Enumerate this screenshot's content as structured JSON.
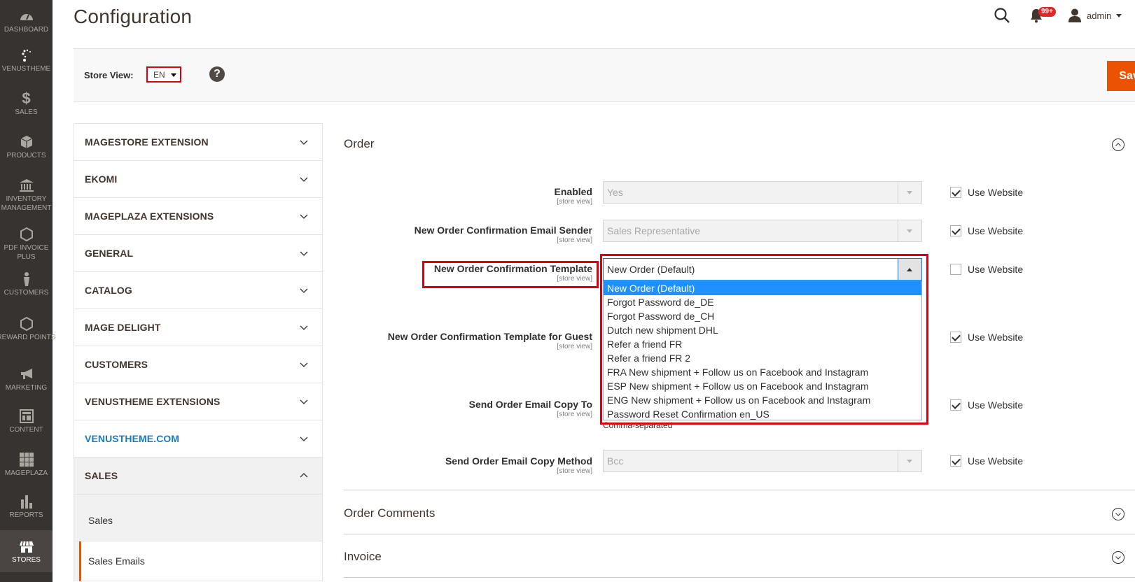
{
  "nav": {
    "items": [
      {
        "label": "DASHBOARD",
        "icon": "dashboard-icon"
      },
      {
        "label": "VENUSTHEME",
        "icon": "venustheme-icon"
      },
      {
        "label": "SALES",
        "icon": "dollar-icon"
      },
      {
        "label": "PRODUCTS",
        "icon": "box-icon"
      },
      {
        "label": "INVENTORY MANAGEMENT",
        "icon": "bank-icon"
      },
      {
        "label": "PDF INVOICE PLUS",
        "icon": "hexagon-icon"
      },
      {
        "label": "CUSTOMERS",
        "icon": "person-icon"
      },
      {
        "label": "REWARD POINTS",
        "icon": "hexagon-icon"
      },
      {
        "label": "MARKETING",
        "icon": "megaphone-icon"
      },
      {
        "label": "CONTENT",
        "icon": "layout-icon"
      },
      {
        "label": "MAGEPLAZA",
        "icon": "grid-icon"
      },
      {
        "label": "REPORTS",
        "icon": "bar-chart-icon"
      },
      {
        "label": "STORES",
        "icon": "storefront-icon",
        "active": true
      }
    ]
  },
  "header": {
    "title": "Configuration",
    "notifications_count": "99+",
    "user": "admin"
  },
  "store_bar": {
    "label": "Store View:",
    "selected": "EN",
    "help": "?",
    "save_label": "Save Config"
  },
  "tabs": [
    {
      "label": "MAGESTORE EXTENSION"
    },
    {
      "label": "EKOMI"
    },
    {
      "label": "MAGEPLAZA EXTENSIONS"
    },
    {
      "label": "GENERAL"
    },
    {
      "label": "CATALOG"
    },
    {
      "label": "MAGE DELIGHT"
    },
    {
      "label": "CUSTOMERS"
    },
    {
      "label": "VENUSTHEME EXTENSIONS"
    },
    {
      "label": "VENUSTHEME.COM",
      "link": true
    },
    {
      "label": "SALES",
      "open": true,
      "children": [
        {
          "label": "Sales"
        },
        {
          "label": "Sales Emails",
          "active": true
        }
      ]
    }
  ],
  "sections": {
    "order": {
      "title": "Order",
      "fields": [
        {
          "label": "Enabled",
          "scope": "[store view]",
          "value": "Yes",
          "use_website": "Use Website",
          "use_website_checked": true
        },
        {
          "label": "New Order Confirmation Email Sender",
          "scope": "[store view]",
          "value": "Sales Representative",
          "use_website": "Use Website",
          "use_website_checked": true
        },
        {
          "label": "New Order Confirmation Template",
          "scope": "[store view]",
          "value": "New Order (Default)",
          "use_website": "Use Website",
          "use_website_checked": false
        },
        {
          "label": "New Order Confirmation Template for Guest",
          "scope": "[store view]",
          "use_website": "Use Website",
          "use_website_checked": true
        },
        {
          "label": "Send Order Email Copy To",
          "scope": "[store view]",
          "hint": "Comma-separated",
          "use_website": "Use Website",
          "use_website_checked": true
        },
        {
          "label": "Send Order Email Copy Method",
          "scope": "[store view]",
          "value": "Bcc",
          "use_website": "Use Website",
          "use_website_checked": true
        }
      ],
      "template_options": [
        "New Order (Default)",
        "Forgot Password de_DE",
        "Forgot Password de_CH",
        "Dutch new shipment DHL",
        "Refer a friend FR",
        "Refer a friend FR 2",
        "FRA New shipment + Follow us on Facebook and Instagram",
        "ESP New shipment + Follow us on Facebook and Instagram",
        "ENG New shipment + Follow us on Facebook and Instagram",
        "Password Reset Confirmation en_US"
      ],
      "template_selected_index": 0
    },
    "order_comments": {
      "title": "Order Comments"
    },
    "invoice": {
      "title": "Invoice"
    }
  },
  "colors": {
    "accent": "#eb5202",
    "nav_bg": "#373330",
    "highlight": "#d8000c",
    "option_selected": "#1e90ff",
    "link": "#1979c3"
  }
}
